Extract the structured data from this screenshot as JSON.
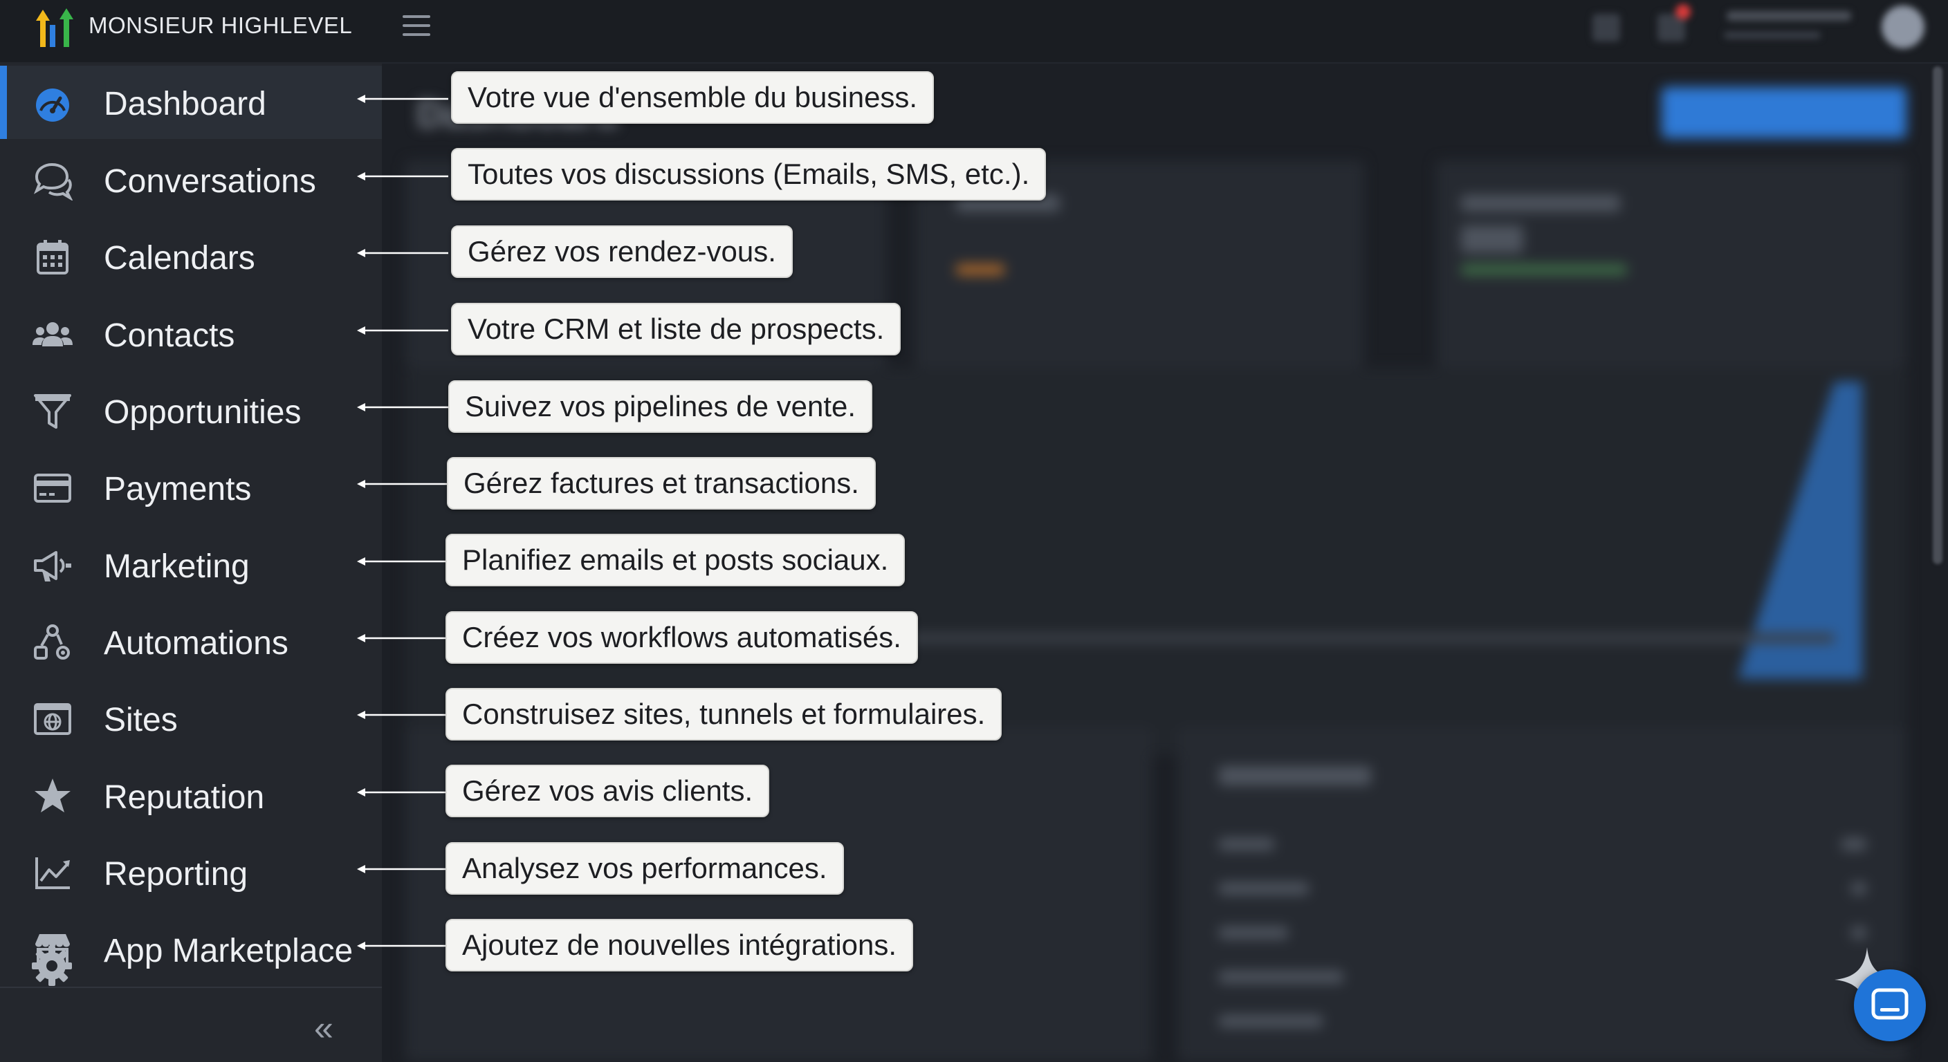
{
  "app": {
    "brand": "MONSIEUR HIGHLEVEL"
  },
  "sidebar": {
    "items": [
      {
        "label": "Dashboard",
        "icon": "dashboard-gauge-icon",
        "active": true
      },
      {
        "label": "Conversations",
        "icon": "chat-bubbles-icon"
      },
      {
        "label": "Calendars",
        "icon": "calendar-icon"
      },
      {
        "label": "Contacts",
        "icon": "users-icon"
      },
      {
        "label": "Opportunities",
        "icon": "funnel-icon"
      },
      {
        "label": "Payments",
        "icon": "credit-card-icon"
      },
      {
        "label": "Marketing",
        "icon": "megaphone-icon"
      },
      {
        "label": "Automations",
        "icon": "workflow-icon"
      },
      {
        "label": "Sites",
        "icon": "globe-window-icon"
      },
      {
        "label": "Reputation",
        "icon": "star-icon"
      },
      {
        "label": "Reporting",
        "icon": "line-chart-icon"
      },
      {
        "label": "App Marketplace",
        "icon": "store-icon"
      }
    ],
    "collapse_glyph": "«"
  },
  "annotations": [
    "Votre vue d'ensemble du business.",
    "Toutes vos discussions (Emails, SMS, etc.).",
    "Gérez vos rendez-vous.",
    "Votre CRM et liste de prospects.",
    "Suivez vos pipelines de vente.",
    "Gérez factures et transactions.",
    "Planifiez emails et posts sociaux.",
    "Créez vos workflows automatisés.",
    "Construisez sites, tunnels et formulaires.",
    "Gérez vos avis clients.",
    "Analysez vos performances.",
    "Ajoutez de nouvelles intégrations."
  ],
  "colors": {
    "accent": "#2f7fe0",
    "sidebar_bg": "#24272d",
    "callout_bg": "#f4f4f2"
  }
}
